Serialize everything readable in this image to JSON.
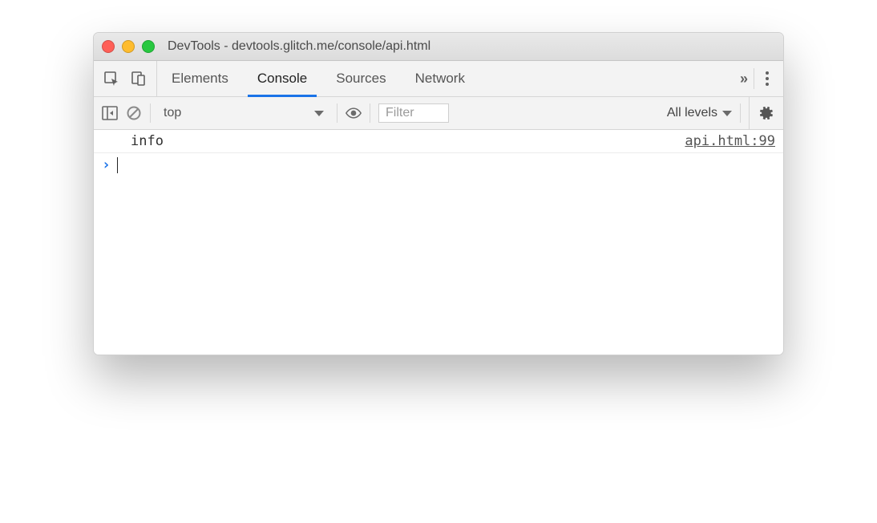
{
  "window": {
    "title": "DevTools - devtools.glitch.me/console/api.html"
  },
  "tabs": {
    "items": [
      "Elements",
      "Console",
      "Sources",
      "Network"
    ],
    "active": "Console",
    "overflow": "»"
  },
  "toolbar": {
    "context": "top",
    "filter_placeholder": "Filter",
    "levels_label": "All levels"
  },
  "console": {
    "entries": [
      {
        "message": "info",
        "source": "api.html:99"
      }
    ]
  }
}
